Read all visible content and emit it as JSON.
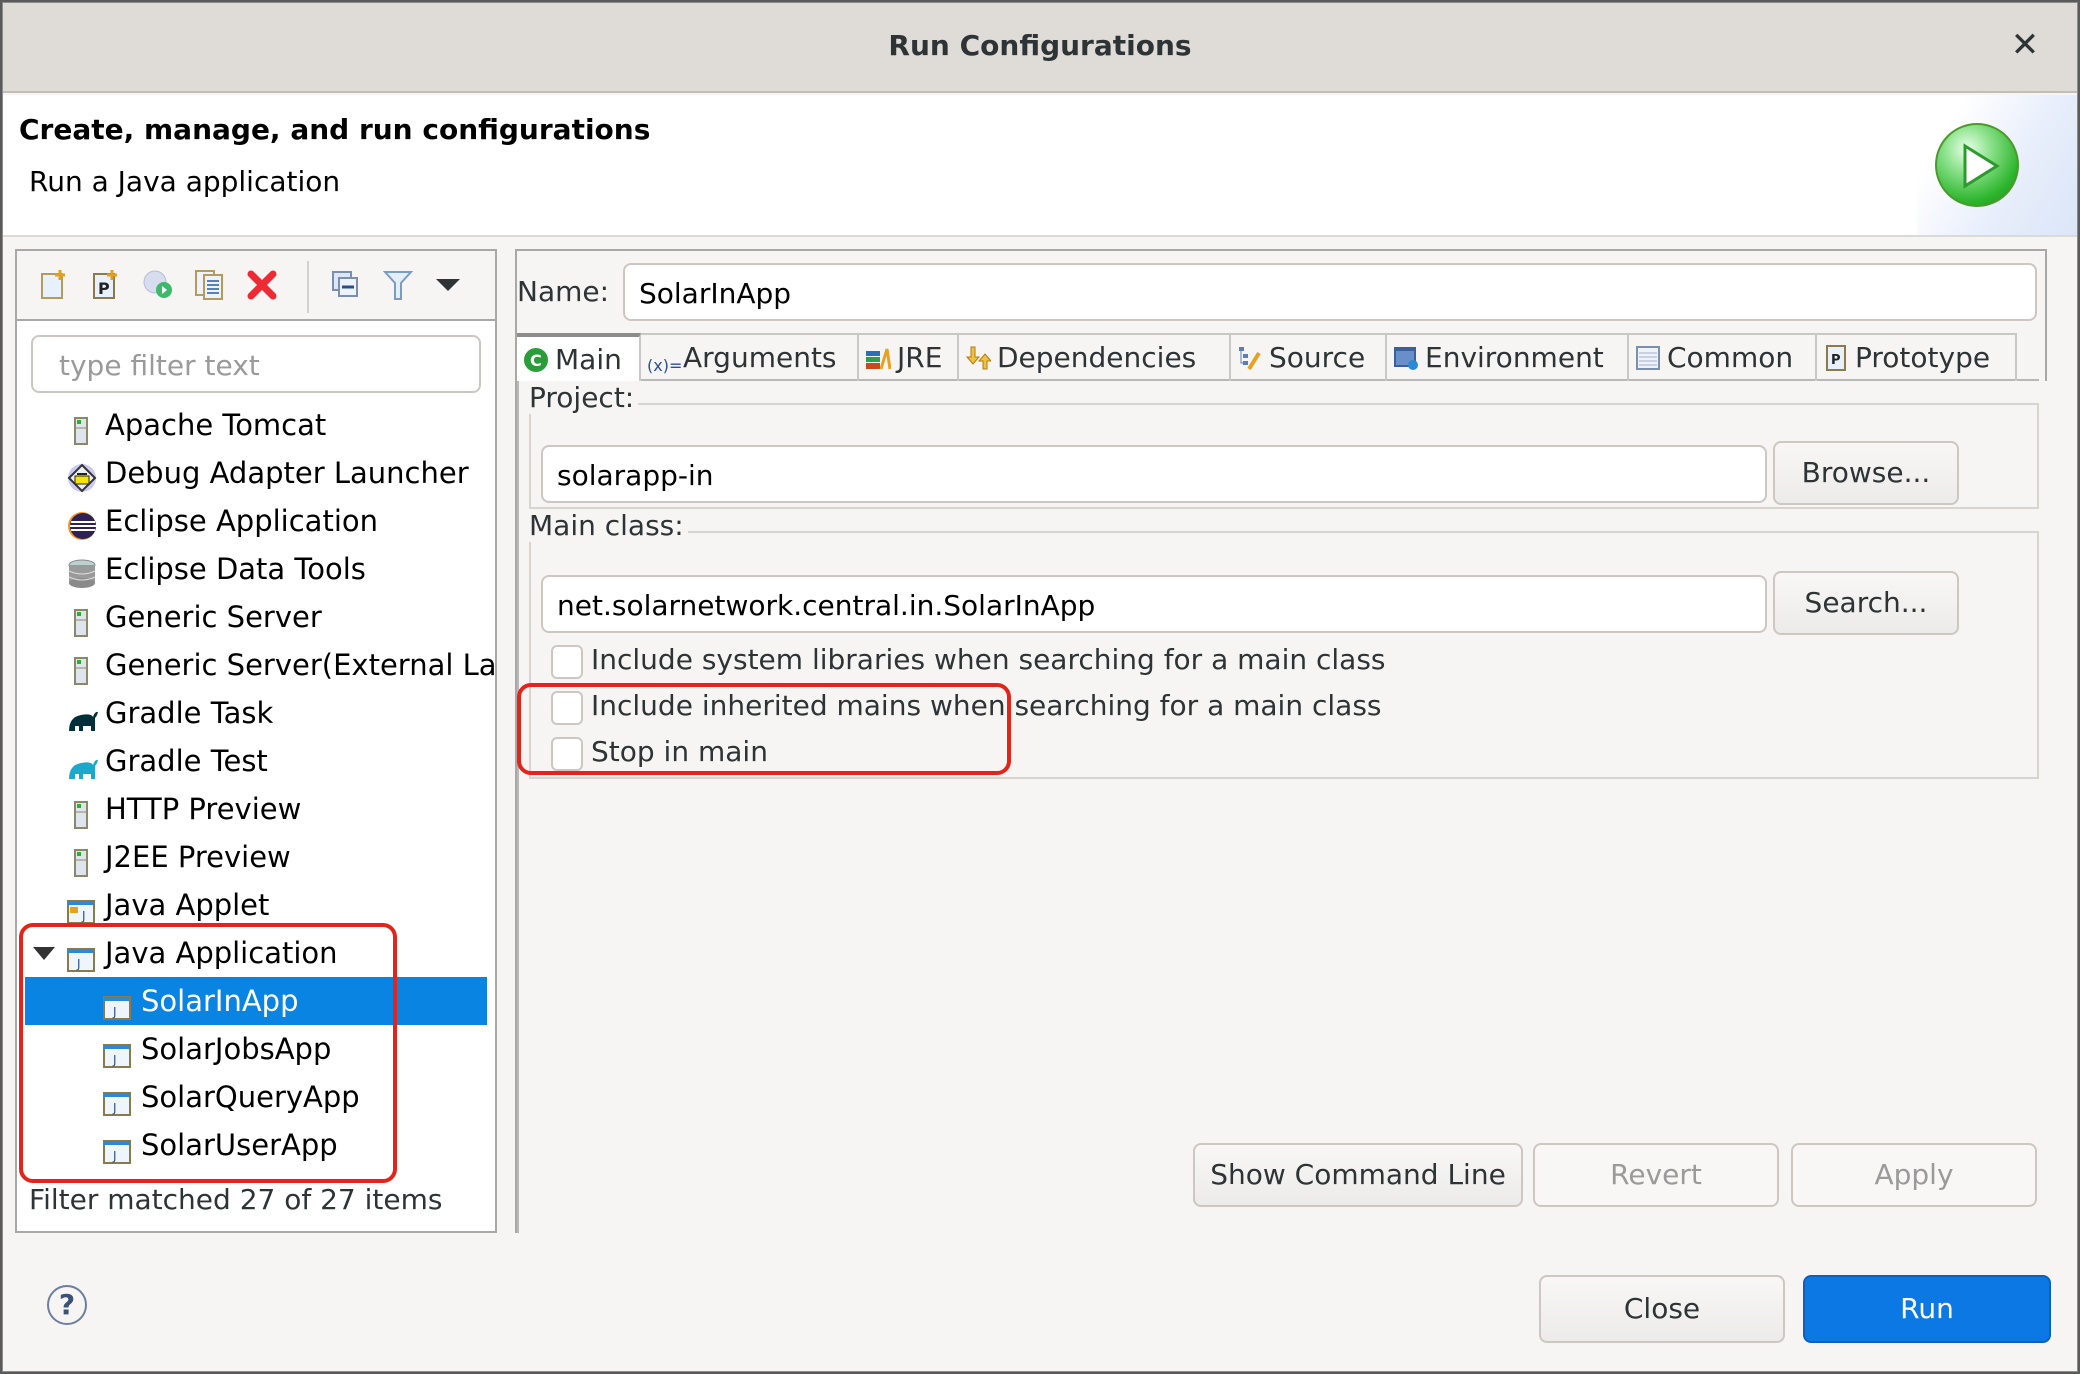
{
  "window": {
    "title": "Run Configurations",
    "close_icon": "close-icon"
  },
  "banner": {
    "heading": "Create, manage, and run configurations",
    "subtitle": "Run a Java application",
    "icon": "run-icon"
  },
  "left_panel": {
    "toolbar": [
      {
        "name": "new-configuration",
        "icon": "new-config-icon"
      },
      {
        "name": "new-prototype",
        "icon": "new-prototype-icon"
      },
      {
        "name": "export",
        "icon": "export-icon"
      },
      {
        "name": "duplicate",
        "icon": "duplicate-icon"
      },
      {
        "name": "delete",
        "icon": "delete-icon"
      },
      {
        "name": "collapse-all",
        "icon": "collapse-all-icon"
      },
      {
        "name": "filter",
        "icon": "filter-icon"
      },
      {
        "name": "view-menu",
        "icon": "chevron-down-icon"
      }
    ],
    "filter_placeholder": "type filter text",
    "tree": [
      {
        "label": "Apache Tomcat",
        "icon": "server-icon"
      },
      {
        "label": "Debug Adapter Launcher",
        "icon": "debug-adapter-icon"
      },
      {
        "label": "Eclipse Application",
        "icon": "eclipse-icon"
      },
      {
        "label": "Eclipse Data Tools",
        "icon": "database-icon"
      },
      {
        "label": "Generic Server",
        "icon": "server-icon"
      },
      {
        "label": "Generic Server(External La",
        "icon": "server-icon"
      },
      {
        "label": "Gradle Task",
        "icon": "gradle-icon"
      },
      {
        "label": "Gradle Test",
        "icon": "gradle-test-icon"
      },
      {
        "label": "HTTP Preview",
        "icon": "server-icon"
      },
      {
        "label": "J2EE Preview",
        "icon": "server-icon"
      },
      {
        "label": "Java Applet",
        "icon": "java-applet-icon"
      },
      {
        "label": "Java Application",
        "icon": "java-app-icon",
        "expanded": true,
        "children": [
          {
            "label": "SolarInApp",
            "selected": true
          },
          {
            "label": "SolarJobsApp"
          },
          {
            "label": "SolarQueryApp"
          },
          {
            "label": "SolarUserApp"
          }
        ]
      }
    ],
    "status": "Filter matched 27 of 27 items"
  },
  "right_panel": {
    "name_label": "Name:",
    "name_value": "SolarInApp",
    "tabs": [
      {
        "label": "Main",
        "icon": "main-tab-icon",
        "active": true
      },
      {
        "label": "Arguments",
        "icon": "arguments-icon"
      },
      {
        "label": "JRE",
        "icon": "jre-icon"
      },
      {
        "label": "Dependencies",
        "icon": "dependencies-icon"
      },
      {
        "label": "Source",
        "icon": "source-icon"
      },
      {
        "label": "Environment",
        "icon": "environment-icon"
      },
      {
        "label": "Common",
        "icon": "common-icon"
      },
      {
        "label": "Prototype",
        "icon": "prototype-icon"
      }
    ],
    "project": {
      "label": "Project:",
      "value": "solarapp-in",
      "button": "Browse..."
    },
    "main_class": {
      "label": "Main class:",
      "value": "net.solarnetwork.central.in.SolarInApp",
      "button": "Search..."
    },
    "checkboxes": [
      {
        "label": "Include system libraries when searching for a main class",
        "checked": false
      },
      {
        "label": "Include inherited mains when searching for a main class",
        "checked": false
      },
      {
        "label": "Stop in main",
        "checked": false
      }
    ],
    "buttons": {
      "show_command_line": "Show Command Line",
      "revert": "Revert",
      "apply": "Apply"
    }
  },
  "footer": {
    "help_icon": "?",
    "close": "Close",
    "run": "Run",
    "accent": "#0b78e3"
  },
  "annotations": {
    "highlight_color": "#e2241a"
  }
}
